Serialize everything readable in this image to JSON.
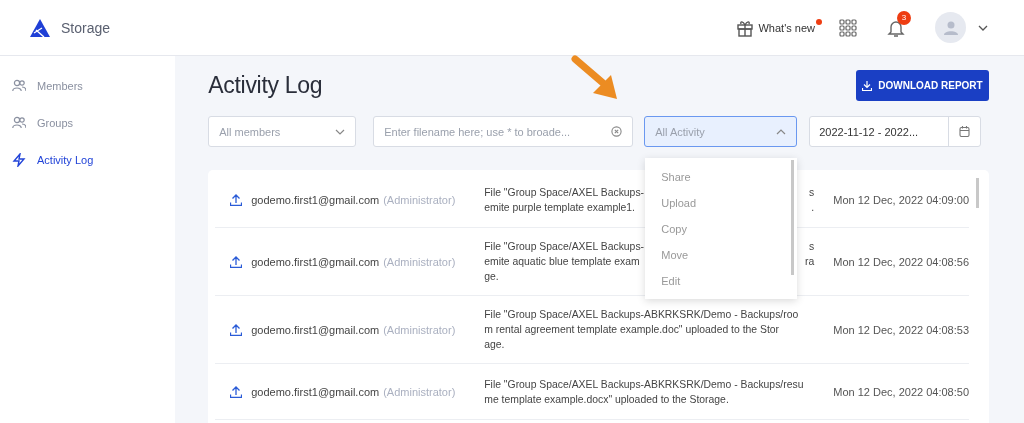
{
  "header": {
    "app_name": "Storage",
    "whats_new": {
      "label": "What's new",
      "unread": true
    },
    "notifications": {
      "count": "3"
    }
  },
  "sidebar": {
    "items": [
      {
        "label": "Members",
        "kind": "people",
        "selected": false
      },
      {
        "label": "Groups",
        "kind": "people",
        "selected": false
      },
      {
        "label": "Activity Log",
        "kind": "bolt",
        "selected": true
      }
    ]
  },
  "page": {
    "title": "Activity Log",
    "download_button": "DOWNLOAD REPORT"
  },
  "filters": {
    "members": {
      "value": "All members"
    },
    "search": {
      "placeholder": "Enter filename here; use * to broade..."
    },
    "activity": {
      "value": "All Activity",
      "expanded": true
    },
    "date": {
      "value": "2022-11-12 - 2022..."
    }
  },
  "activity_menu": {
    "items": [
      "Share",
      "Upload",
      "Copy",
      "Move",
      "Edit"
    ]
  },
  "log": {
    "rows": [
      {
        "user": "godemo.first1@gmail.com",
        "role": "(Administrator)",
        "description": [
          [
            "File \"Group Space/AXEL Backups-",
            "s"
          ],
          [
            "emite purple template example1.",
            "."
          ]
        ],
        "time": "Mon 12 Dec, 2022 04:09:00"
      },
      {
        "user": "godemo.first1@gmail.com",
        "role": "(Administrator)",
        "description": [
          [
            "File \"Group Space/AXEL Backups-",
            "s"
          ],
          [
            "emite aquatic blue template exam",
            "ra"
          ],
          [
            "ge."
          ]
        ],
        "time": "Mon 12 Dec, 2022 04:08:56"
      },
      {
        "user": "godemo.first1@gmail.com",
        "role": "(Administrator)",
        "description": [
          [
            "File \"Group Space/AXEL Backups-ABKRKSRK/Demo - Backups/roo"
          ],
          [
            "m rental agreement template example.doc\" uploaded to the Stor"
          ],
          [
            "age."
          ]
        ],
        "time": "Mon 12 Dec, 2022 04:08:53"
      },
      {
        "user": "godemo.first1@gmail.com",
        "role": "(Administrator)",
        "description": [
          [
            "File \"Group Space/AXEL Backups-ABKRKSRK/Demo - Backups/resu"
          ],
          [
            "me template example.docx\" uploaded to the Storage."
          ]
        ],
        "time": "Mon 12 Dec, 2022 04:08:50"
      }
    ]
  }
}
